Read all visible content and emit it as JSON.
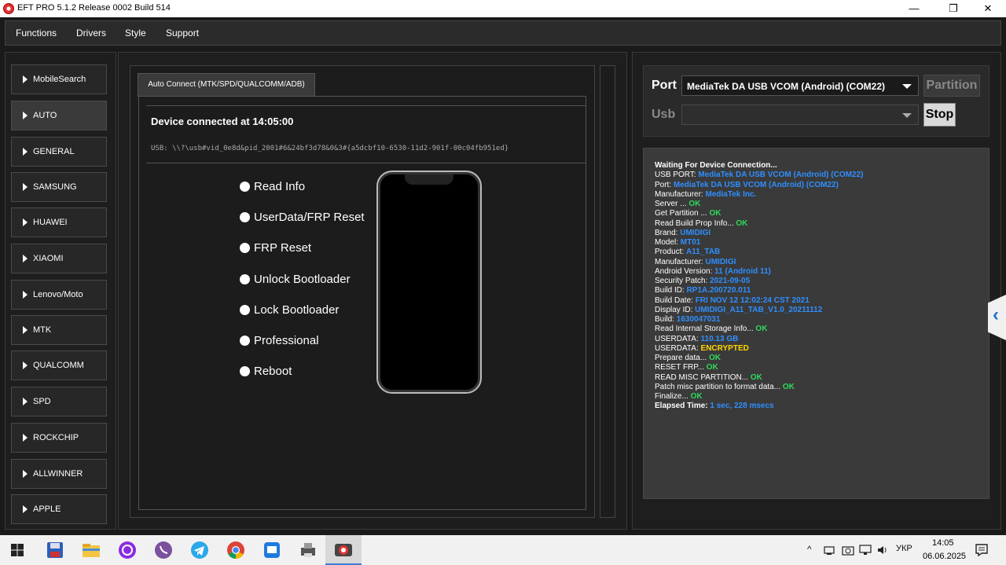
{
  "window": {
    "title": "EFT PRO 5.1.2 Release 0002 Build 514",
    "minimize_glyph": "—",
    "restore_glyph": "❐",
    "close_glyph": "✕"
  },
  "menu": {
    "items": [
      "Functions",
      "Drivers",
      "Style",
      "Support"
    ]
  },
  "sidebar": {
    "items": [
      "MobileSearch",
      "AUTO",
      "GENERAL",
      "SAMSUNG",
      "HUAWEI",
      "XIAOMI",
      "Lenovo/Moto",
      "MTK",
      "QUALCOMM",
      "SPD",
      "ROCKCHIP",
      "ALLWINNER",
      "APPLE"
    ],
    "active": "AUTO"
  },
  "main": {
    "tab_label": "Auto Connect (MTK/SPD/QUALCOMM/ADB)",
    "device_title": "Device connected at 14:05:00",
    "usb_path": "USB: \\\\?\\usb#vid_0e8d&pid_2001#6&24bf3d78&0&3#{a5dcbf10-6530-11d2-901f-00c04fb951ed}",
    "options": [
      "Read Info",
      "UserData/FRP Reset",
      "FRP Reset",
      "Unlock Bootloader",
      "Lock Bootloader",
      "Professional",
      "Reboot"
    ]
  },
  "connection": {
    "port_label": "Port",
    "port_value": "MediaTek DA USB VCOM (Android) (COM22)",
    "usb_label": "Usb",
    "usb_value": "",
    "partition_label": "Partition",
    "stop_label": "Stop"
  },
  "log": {
    "lines": [
      {
        "label": "Waiting For Device Connection...",
        "value": "",
        "color": "",
        "bold": true
      },
      {
        "label": "USB PORT: ",
        "value": "MediaTek DA USB VCOM (Android) (COM22)",
        "color": "blue"
      },
      {
        "label": "Port: ",
        "value": "MediaTek DA USB VCOM (Android) (COM22)",
        "color": "blue"
      },
      {
        "label": "Manufacturer: ",
        "value": "MediaTek Inc.",
        "color": "blue"
      },
      {
        "label": "Server ... ",
        "value": "OK",
        "color": "green"
      },
      {
        "label": "Get Partition ... ",
        "value": "OK",
        "color": "green"
      },
      {
        "label": "Read Build Prop Info... ",
        "value": "OK",
        "color": "green"
      },
      {
        "label": " Brand: ",
        "value": "UMIDIGI",
        "color": "blue"
      },
      {
        "label": " Model: ",
        "value": "MT01",
        "color": "blue"
      },
      {
        "label": " Product: ",
        "value": "A11_TAB",
        "color": "blue"
      },
      {
        "label": " Manufacturer: ",
        "value": "UMIDIGI",
        "color": "blue"
      },
      {
        "label": " Android Version: ",
        "value": "11 (Android 11)",
        "color": "blue"
      },
      {
        "label": " Security Patch: ",
        "value": "2021-09-05",
        "color": "blue"
      },
      {
        "label": " Build ID: ",
        "value": "RP1A.200720.011",
        "color": "blue"
      },
      {
        "label": " Build Date: ",
        "value": "FRI NOV 12 12:02:24 CST 2021",
        "color": "blue"
      },
      {
        "label": " Display ID: ",
        "value": "UMIDIGI_A11_TAB_V1.0_20211112",
        "color": "blue"
      },
      {
        "label": " Build: ",
        "value": "1630047031",
        "color": "blue"
      },
      {
        "label": "Read Internal Storage Info... ",
        "value": "OK",
        "color": "green"
      },
      {
        "label": "USERDATA: ",
        "value": "110.13 GB",
        "color": "blue"
      },
      {
        "label": "USERDATA: ",
        "value": "ENCRYPTED",
        "color": "yellow"
      },
      {
        "label": "Prepare data... ",
        "value": "OK",
        "color": "green"
      },
      {
        "label": "RESET FRP... ",
        "value": "OK",
        "color": "green"
      },
      {
        "label": "READ MISC PARTITION... ",
        "value": "OK",
        "color": "green"
      },
      {
        "label": "Patch misc partition to format data... ",
        "value": "OK",
        "color": "green"
      },
      {
        "label": "Finalize... ",
        "value": "OK",
        "color": "green"
      },
      {
        "label": "Elapsed Time: ",
        "value": "1 sec, 228 msecs",
        "color": "blue",
        "bold": true
      }
    ]
  },
  "side_tab": {
    "glyph": "‹"
  },
  "taskbar": {
    "icons": [
      "windows-start-icon",
      "save-disk-icon",
      "file-explorer-icon",
      "music-player-icon",
      "viber-icon",
      "telegram-icon",
      "chrome-icon",
      "remote-desktop-icon",
      "printer-app-icon",
      "eft-pro-icon"
    ],
    "tray_glyphs": {
      "chevron": "^",
      "language": "УКР"
    },
    "time": "14:05",
    "date": "06.06.2025"
  },
  "colors": {
    "blue": "#2f8fff",
    "green": "#2fd95a",
    "yellow": "#ffd400"
  }
}
